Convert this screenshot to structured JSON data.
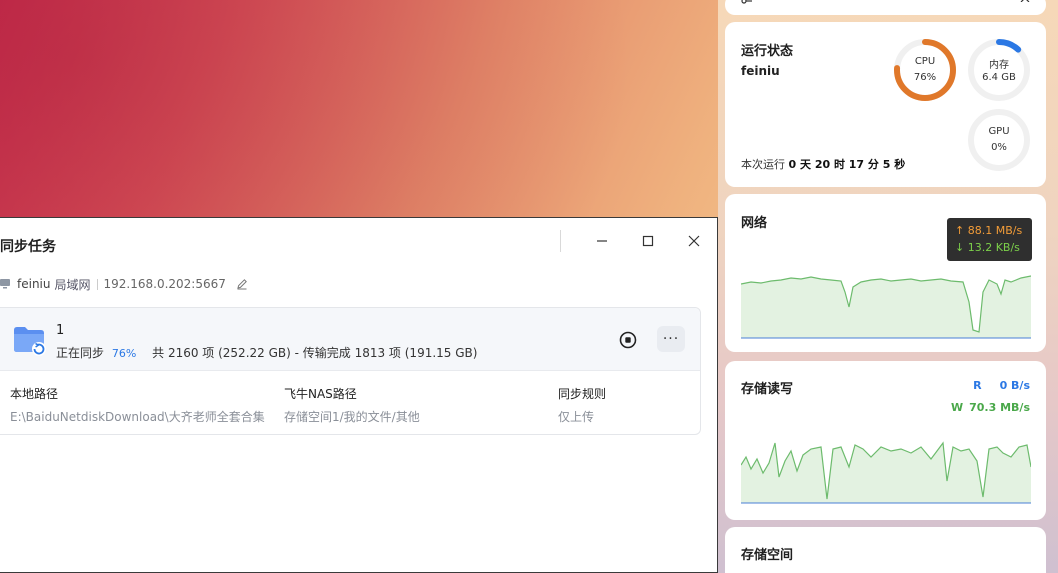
{
  "sync_window": {
    "title": "同步任务",
    "connection": {
      "device": "feiniu",
      "network": "局域网",
      "address": "192.168.0.202:5667"
    },
    "task": {
      "name": "1",
      "status": "正在同步",
      "progress": "76%",
      "summary": "共 2160 项 (252.22 GB) - 传输完成 1813 项 (191.15 GB)",
      "local_path_label": "本地路径",
      "local_path": "E:\\BaiduNetdiskDownload\\大齐老师全套合集",
      "nas_path_label": "飞牛NAS路径",
      "nas_path": "存储空间1/我的文件/其他",
      "rule_label": "同步规则",
      "rule": "仅上传",
      "more_label": "···"
    }
  },
  "widgets": {
    "status": {
      "title": "运行状态",
      "host": "feiniu",
      "uptime_label": "本次运行",
      "uptime": "0 天 20 时 17 分 5 秒",
      "cpu": {
        "label": "CPU",
        "value": "76%",
        "fraction": 0.76,
        "color": "#e0782a"
      },
      "memory": {
        "label": "内存",
        "value": "6.4 GB",
        "fraction": 0.12,
        "color": "#2b78e4"
      },
      "gpu": {
        "label": "GPU",
        "value": "0%",
        "fraction": 0.0,
        "color": "#2b78e4"
      }
    },
    "network": {
      "title": "网络",
      "upload": "↑ 88.1 MB/s",
      "download": "↓ 13.2 KB/s"
    },
    "storage_io": {
      "title": "存储读写",
      "read_key": "R",
      "read_value": "0 B/s",
      "write_key": "W",
      "write_value": "70.3 MB/s"
    },
    "storage_space": {
      "title": "存储空间"
    }
  },
  "colors": {
    "accent": "#2b78e4",
    "cpu": "#e0782a",
    "chart_line": "#6dbb6d",
    "chart_fill": "#e3f2e1",
    "upload": "#f29c38",
    "download": "#7ccf4a"
  },
  "icons": {
    "folder": "folder-sync-icon",
    "stop": "stop-icon",
    "edit": "edit-icon",
    "pc": "computer-icon"
  }
}
